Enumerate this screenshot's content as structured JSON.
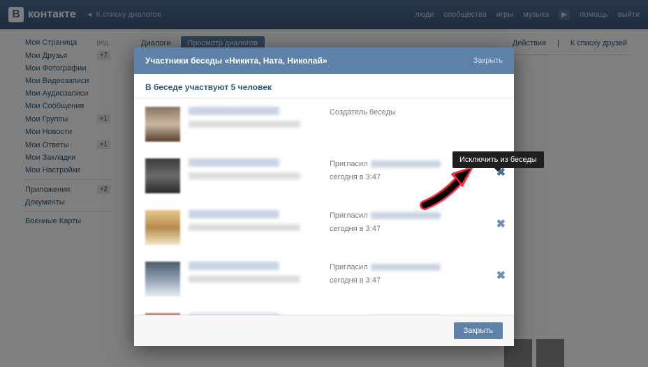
{
  "header": {
    "logo_text": "контакте",
    "logo_letter": "В",
    "back_to_dialogs": "К списку диалогов",
    "nav": {
      "people": "люди",
      "communities": "сообщества",
      "games": "игры",
      "music": "музыка",
      "help": "помощь",
      "logout": "выйти"
    }
  },
  "sidebar": {
    "items": [
      {
        "label": "Моя Страница",
        "extra": "ред."
      },
      {
        "label": "Мои Друзья",
        "badge": "+7"
      },
      {
        "label": "Мои Фотографии"
      },
      {
        "label": "Мои Видеозаписи"
      },
      {
        "label": "Мои Аудиозаписи"
      },
      {
        "label": "Мои Сообщения"
      },
      {
        "label": "Мои Группы",
        "badge": "+1"
      },
      {
        "label": "Мои Новости"
      },
      {
        "label": "Мои Ответы",
        "badge": "+1"
      },
      {
        "label": "Мои Закладки"
      },
      {
        "label": "Мои Настройки"
      }
    ],
    "apps": {
      "label": "Приложения",
      "badge": "+2"
    },
    "docs": "Документы",
    "war_maps": "Военные Карты"
  },
  "tabs": {
    "dialogs": "Диалоги",
    "view_dialogs": "Просмотр диалогов",
    "actions": "Действия",
    "to_friends": "К списку друзей"
  },
  "modal": {
    "title": "Участники беседы «Никита, Ната, Николай»",
    "close_top": "Закрыть",
    "subheader": "В беседе участвуют 5 человек",
    "creator_label": "Создатель беседы",
    "invited_by": "Пригласил",
    "invited_time": "сегодня в 3:47",
    "close_btn": "Закрыть"
  },
  "tooltip": {
    "exclude": "Исключить из беседы"
  }
}
